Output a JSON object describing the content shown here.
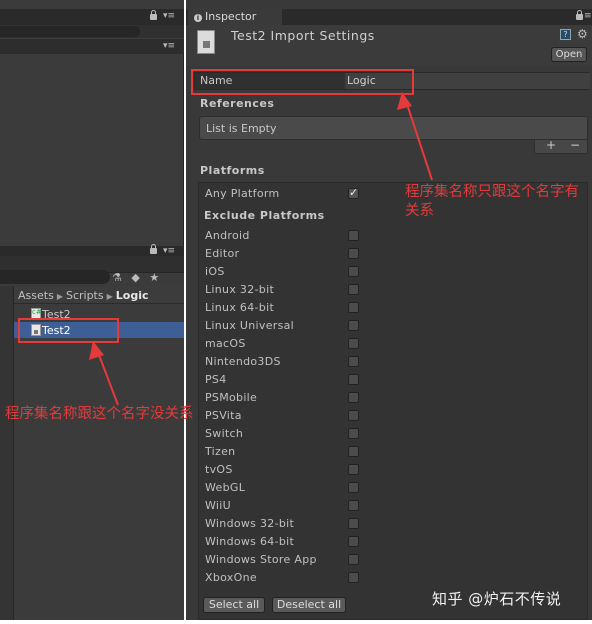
{
  "inspector": {
    "tab_label": "Inspector",
    "title": "Test2 Import Settings",
    "open_label": "Open",
    "name_label": "Name",
    "name_value": "Logic",
    "references_label": "References",
    "references_empty": "List is Empty",
    "add_label": "+",
    "remove_label": "−",
    "platforms_label": "Platforms",
    "any_platform_label": "Any Platform",
    "any_platform_checked": true,
    "exclude_label": "Exclude Platforms",
    "platforms": [
      "Android",
      "Editor",
      "iOS",
      "Linux 32-bit",
      "Linux 64-bit",
      "Linux Universal",
      "macOS",
      "Nintendo3DS",
      "PS4",
      "PSMobile",
      "PSVita",
      "Switch",
      "Tizen",
      "tvOS",
      "WebGL",
      "WiiU",
      "Windows 32-bit",
      "Windows 64-bit",
      "Windows Store App",
      "XboxOne"
    ],
    "select_all_label": "Select all",
    "deselect_all_label": "Deselect all"
  },
  "project": {
    "breadcrumb": [
      "Assets",
      "Scripts",
      "Logic"
    ],
    "files": [
      {
        "name": "Test2",
        "type": "cs"
      },
      {
        "name": "Test2",
        "type": "asm",
        "selected": true
      }
    ]
  },
  "annotations": {
    "top_note": "程序集名称只跟这个名字有关系",
    "bottom_note": "程序集名称跟这个名字没关系",
    "color": "#e53a3a"
  },
  "watermark": "知乎 @炉石不传说",
  "colors": {
    "panel_bg": "#393939",
    "selection": "#3e5f96",
    "annotation": "#e53a3a"
  }
}
